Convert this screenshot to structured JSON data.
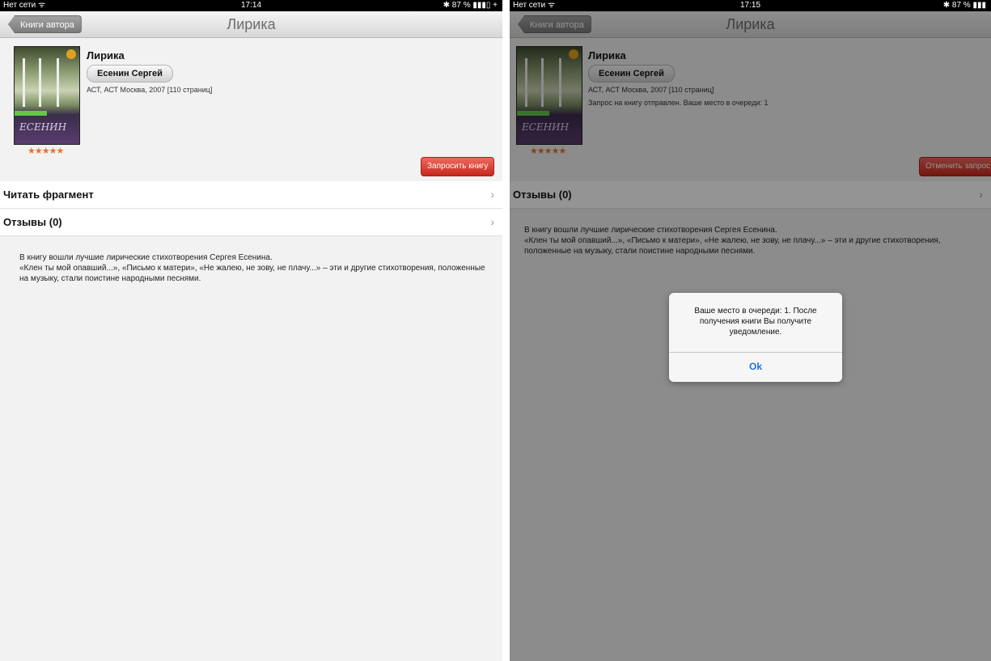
{
  "left": {
    "status": {
      "carrier": "Нет сети ᯤ",
      "time": "17:14",
      "battery": "✱ 87 % ▮▮▮▯ +"
    },
    "nav": {
      "back_label": "Книги автора",
      "title": "Лирика"
    },
    "book": {
      "title": "Лирика",
      "author": "Есенин Сергей",
      "publisher": "АСТ, АСТ Москва, 2007 [110 страниц]",
      "rating": "★★★★★",
      "cover_text": "ЕСЕНИН"
    },
    "request_button": "Запросить книгу",
    "rows": [
      {
        "label": "Читать фрагмент"
      },
      {
        "label": "Отзывы (0)"
      }
    ],
    "description": [
      "В книгу вошли лучшие лирические стихотворения Сергея Есенина.",
      "«Клен ты мой опавший...», «Письмо к матери», «Не жалею, не зову, не плачу...» – эти и другие стихотворения, положенные на музыку, стали поистине народными песнями."
    ]
  },
  "right": {
    "status": {
      "carrier": "Нет сети ᯤ",
      "time": "17:15",
      "battery": "✱ 87 % ▮▮▮"
    },
    "nav": {
      "back_label": "Книги автора",
      "title": "Лирика"
    },
    "book": {
      "title": "Лирика",
      "author": "Есенин Сергей",
      "publisher": "АСТ, АСТ Москва, 2007 [110 страниц]",
      "queue_note": "Запрос на книгу отправлен. Ваше место в очереди: 1",
      "rating": "★★★★★",
      "cover_text": "ЕСЕНИН"
    },
    "cancel_button": "Отменить запрос",
    "rows": [
      {
        "label": "Отзывы (0)"
      }
    ],
    "description": [
      "В книгу вошли лучшие лирические стихотворения Сергея Есенина.",
      "«Клен ты мой опавший...», «Письмо к матери», «Не жалею, не зову, не плачу...» – эти и другие стихотворения, положенные на музыку, стали поистине народными песнями."
    ],
    "alert": {
      "message": "Ваше место в очереди: 1. После получения книги Вы получите уведомление.",
      "ok_label": "Ok"
    }
  },
  "colors": {
    "arrow": "#2e7d1a",
    "request_button": "#d8372b",
    "link_blue": "#1a73e8",
    "stars": "#e8732d"
  }
}
